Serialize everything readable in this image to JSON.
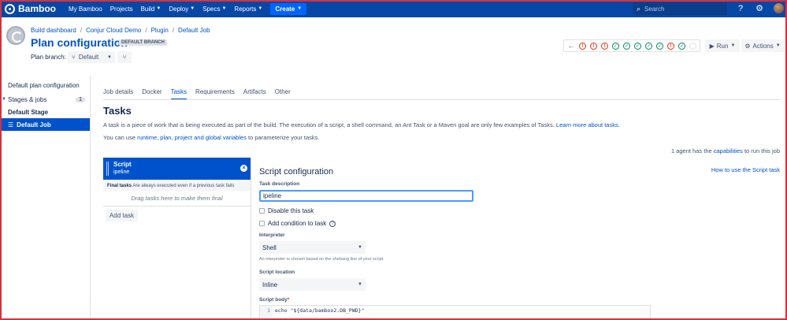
{
  "topnav": {
    "brand": "Bamboo",
    "items": [
      {
        "label": "My Bamboo",
        "has_caret": false
      },
      {
        "label": "Projects",
        "has_caret": false
      },
      {
        "label": "Build",
        "has_caret": true
      },
      {
        "label": "Deploy",
        "has_caret": true
      },
      {
        "label": "Specs",
        "has_caret": true
      },
      {
        "label": "Reports",
        "has_caret": true
      }
    ],
    "create_label": "Create",
    "search_placeholder": "Search"
  },
  "header": {
    "breadcrumb": [
      "Build dashboard",
      "Conjur Cloud Demo",
      "Plugin",
      "Default Job"
    ],
    "title": "Plan configuration",
    "branch_lozenge": "DEFAULT BRANCH",
    "branch_label": "Plan branch:",
    "branch_value": "Default"
  },
  "recent_builds": [
    "fail",
    "fail",
    "fail",
    "ok",
    "ok",
    "ok",
    "ok",
    "ok",
    "fail",
    "ok",
    "empty"
  ],
  "buttons": {
    "run": "Run",
    "actions": "Actions"
  },
  "sidebar": {
    "items": [
      {
        "label": "Default plan configuration",
        "count": "",
        "style": "normal"
      },
      {
        "label": "Stages & jobs",
        "count": "1",
        "style": "normal"
      },
      {
        "label": "Default Stage",
        "count": "",
        "style": "bold"
      },
      {
        "label": "Default Job",
        "count": "",
        "style": "active"
      }
    ]
  },
  "tabs": [
    "Job details",
    "Docker",
    "Tasks",
    "Requirements",
    "Artifacts",
    "Other"
  ],
  "active_tab": "Tasks",
  "main": {
    "heading": "Tasks",
    "desc_text": "A task is a piece of work that is being executed as part of the build. The execution of a script, a shell command, an Ant Task or a Maven goal are only few examples of Tasks.",
    "desc_link": "Learn more about tasks.",
    "vars_pre": "You can use",
    "vars_link": "runtime, plan, project and global variables",
    "vars_post": "to parameterize your tasks.",
    "agents_pre": "1 agent has the",
    "agents_link": "capabilities",
    "agents_post": "to run this job"
  },
  "task_list": {
    "task_name": "Script",
    "task_desc": "ipeline",
    "final_label": "Final tasks",
    "final_desc": "Are always executed even if a previous task fails",
    "drag_hint": "Drag tasks here to make them final",
    "add_task": "Add task"
  },
  "config": {
    "title": "Script configuration",
    "howto": "How to use the Script task",
    "task_desc_label": "Task description",
    "task_desc_value": "ipeline",
    "disable_label": "Disable this task",
    "condition_label": "Add condition to task",
    "interpreter_label": "Interpreter",
    "interpreter_value": "Shell",
    "interpreter_hint": "An interpreter is chosen based on the shebang line of your script.",
    "location_label": "Script location",
    "location_value": "Inline",
    "body_label": "Script body",
    "body_line_no": "1",
    "body_code": "echo \"${data/bamboo2.DB_PWD}\""
  },
  "colors": {
    "nav_bg": "#0747a6",
    "accent": "#0052cc",
    "fail": "#de350b",
    "success": "#00875a",
    "frame": "#d9303a"
  }
}
